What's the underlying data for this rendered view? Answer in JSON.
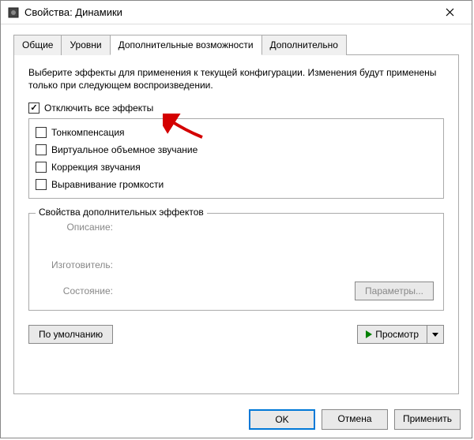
{
  "titlebar": {
    "title": "Свойства: Динамики"
  },
  "tabs": {
    "general": "Общие",
    "levels": "Уровни",
    "enhancements": "Дополнительные возможности",
    "advanced": "Дополнительно"
  },
  "panel": {
    "description": "Выберите эффекты для применения к текущей конфигурации. Изменения будут применены только при следующем воспроизведении.",
    "disable_all": "Отключить все эффекты",
    "effects": {
      "0": "Тонкомпенсация",
      "1": "Виртуальное объемное звучание",
      "2": "Коррекция звучания",
      "3": "Выравнивание громкости"
    },
    "props": {
      "legend": "Свойства дополнительных эффектов",
      "description_label": "Описание:",
      "vendor_label": "Изготовитель:",
      "status_label": "Состояние:",
      "params_button": "Параметры..."
    },
    "defaults_button": "По умолчанию",
    "preview_button": "Просмотр"
  },
  "buttons": {
    "ok": "OK",
    "cancel": "Отмена",
    "apply": "Применить"
  }
}
